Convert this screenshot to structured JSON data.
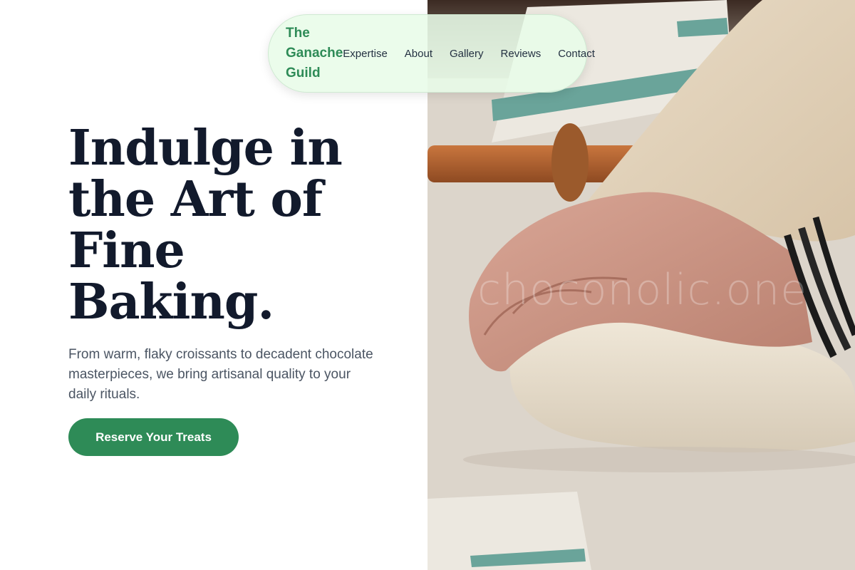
{
  "nav": {
    "brand": "The Ganache Guild",
    "links": [
      "Expertise",
      "About",
      "Gallery",
      "Reviews",
      "Contact"
    ]
  },
  "hero": {
    "title": "Indulge in the Art of Fine Baking.",
    "subtitle": "From warm, flaky croissants to decadent chocolate masterpieces, we bring artisanal quality to your daily rituals.",
    "cta_label": "Reserve Your Treats"
  },
  "image": {
    "watermark": "choconolic.one"
  },
  "colors": {
    "accent": "#2e8b57",
    "title": "#121a2c",
    "body_text": "#4b5563",
    "nav_bg": "#e8fce8"
  }
}
